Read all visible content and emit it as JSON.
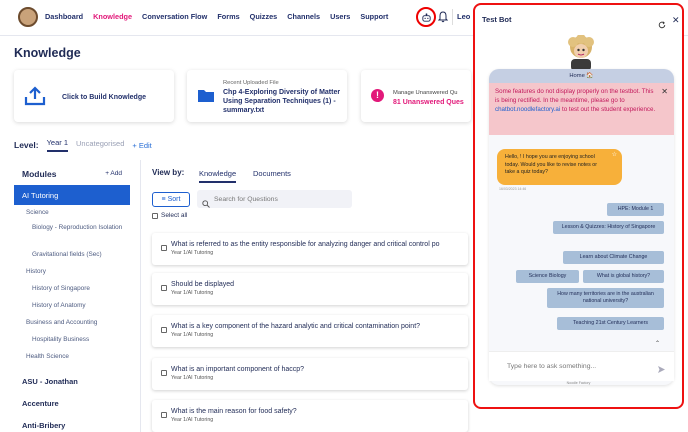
{
  "nav": {
    "links": [
      "Dashboard",
      "Knowledge",
      "Conversation Flow",
      "Forms",
      "Quizzes",
      "Channels",
      "Users",
      "Support"
    ],
    "active": "Knowledge",
    "user_initials": "Leo"
  },
  "page": {
    "title": "Knowledge"
  },
  "cards": {
    "build_label": "Click to Build Knowledge",
    "recent_small": "Recent Uploaded File",
    "recent_title": "Chp 4-Exploring Diversity of Matter Using Separation Techniques (1) - summary.txt",
    "unanswered_small": "Manage Unanswered Qu",
    "unanswered_title": "81 Unanswered Ques"
  },
  "level": {
    "label": "Level:",
    "tabs": [
      "Year 1",
      "Uncategorised"
    ],
    "edit": "+ Edit"
  },
  "modules": {
    "title": "Modules",
    "add": "+ Add",
    "active": "AI Tutoring",
    "tree": [
      {
        "label": "Science",
        "indent": 1
      },
      {
        "label": "Biology - Reproduction Isolation",
        "indent": 2
      },
      {
        "label": "Gravitational fields (Sec)",
        "indent": 2
      },
      {
        "label": "History",
        "indent": 1
      },
      {
        "label": "History of Singapore",
        "indent": 2
      },
      {
        "label": "History of Anatomy",
        "indent": 2
      },
      {
        "label": "Business and Accounting",
        "indent": 1
      },
      {
        "label": "Hospitality Business",
        "indent": 2
      },
      {
        "label": "Health Science",
        "indent": 1
      }
    ],
    "others": [
      "ASU - Jonathan",
      "Accenture",
      "Anti-Bribery"
    ]
  },
  "view": {
    "label": "View by:",
    "tabs": [
      "Knowledge",
      "Documents"
    ],
    "sort": "Sort",
    "search_placeholder": "Search for Questions",
    "select_all": "Select all"
  },
  "questions": [
    {
      "title": "What is referred to as the entity responsible for analyzing danger and critical control po",
      "sub": "Year 1/AI Tutoring"
    },
    {
      "title": "Should be displayed",
      "sub": "Year 1/AI Tutoring"
    },
    {
      "title": "What is a key component of the hazard analytic and critical contamination point?",
      "sub": "Year 1/AI Tutoring"
    },
    {
      "title": "What is an important component of haccp?",
      "sub": "Year 1/AI Tutoring"
    },
    {
      "title": "What is the main reason for food safety?",
      "sub": "Year 1/AI Tutoring"
    }
  ],
  "chat": {
    "title": "Test Bot",
    "home": "Home 🏠",
    "alert_pre": "Some features do not display properly on the testbot. This is being rectified. In the meantime, please go to ",
    "alert_link": "chatbot.noodlefactory.ai",
    "alert_post": " to test out the student experience.",
    "bot_message": "Hello, ! I hope you are enjoying school today. Would you like to revise notes or take a quiz today?",
    "time": "16/03/2023 14:46",
    "suggestions": [
      "HPE: Module 1",
      "Lesson & Quizzes: History of Singapore",
      "Learn about Climate Change",
      "Science Biology",
      "What is global history?",
      "How many territories are in the australian national university?",
      "Teaching 21st Century Learners"
    ],
    "input_placeholder": "Type here to ask something...",
    "powered": "Noodle Factory"
  },
  "colors": {
    "accent": "#e2197a",
    "primary": "#1d5fcf",
    "bubble": "#f7b03a",
    "alert": "#f5c6cb",
    "highlight": "#e00000"
  }
}
